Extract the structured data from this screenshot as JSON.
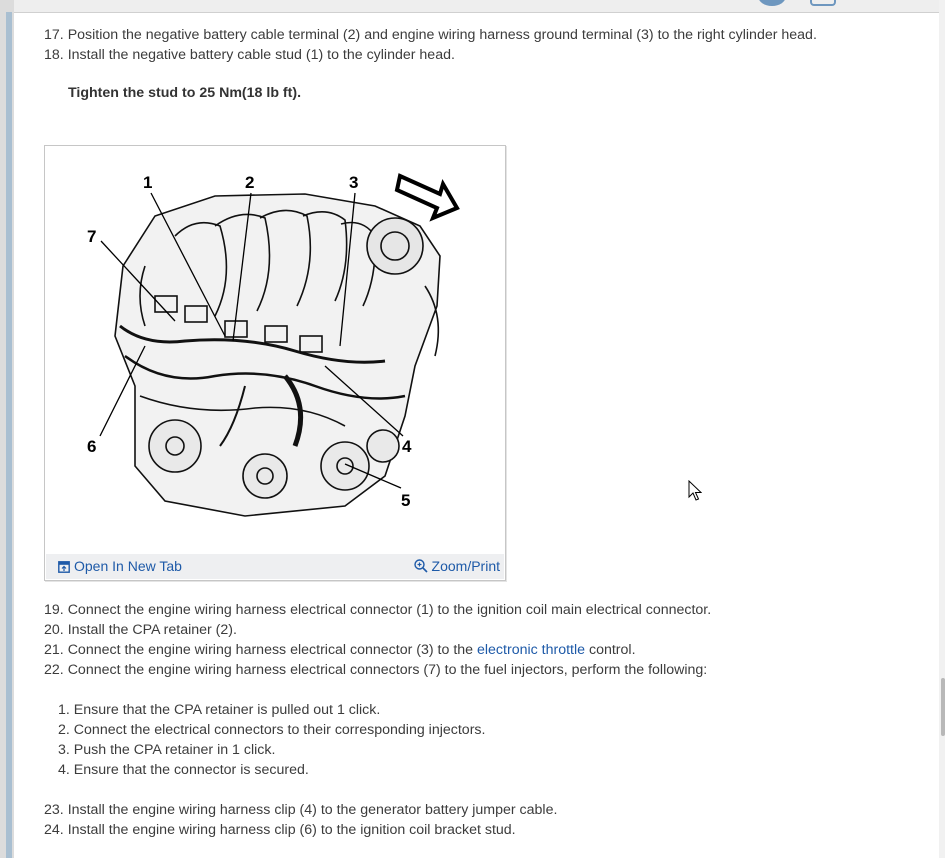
{
  "steps_top": [
    {
      "num": "17.",
      "text": "Position the negative battery cable terminal (2) and engine wiring harness ground terminal (3) to the right cylinder head."
    },
    {
      "num": "18.",
      "text": "Install the negative battery cable stud (1) to the cylinder head."
    }
  ],
  "note": "Tighten the stud to 25 Nm(18 lb ft).",
  "figure": {
    "callouts": [
      "1",
      "2",
      "3",
      "4",
      "5",
      "6",
      "7"
    ],
    "open_tab_label": "Open In New Tab",
    "zoom_label": "Zoom/Print"
  },
  "steps_mid": [
    {
      "num": "19.",
      "text": "Connect the engine wiring harness electrical connector (1) to the ignition coil main electrical connector."
    },
    {
      "num": "20.",
      "text": "Install the CPA retainer (2)."
    },
    {
      "num": "21.",
      "pre": "Connect the engine wiring harness electrical connector (3) to the ",
      "link": "electronic throttle",
      "post": " control."
    },
    {
      "num": "22.",
      "text": "Connect the engine wiring harness electrical connectors (7) to the fuel injectors, perform the following:"
    }
  ],
  "substeps": [
    {
      "num": "1.",
      "text": "Ensure that the CPA retainer is pulled out 1 click."
    },
    {
      "num": "2.",
      "text": "Connect the electrical connectors to their corresponding injectors."
    },
    {
      "num": "3.",
      "text": "Push the CPA retainer in 1 click."
    },
    {
      "num": "4.",
      "text": "Ensure that the connector is secured."
    }
  ],
  "steps_bottom": [
    {
      "num": "23.",
      "text": "Install the engine wiring harness clip (4) to the generator battery jumper cable."
    },
    {
      "num": "24.",
      "text": "Install the engine wiring harness clip (6) to the ignition coil bracket stud."
    }
  ]
}
